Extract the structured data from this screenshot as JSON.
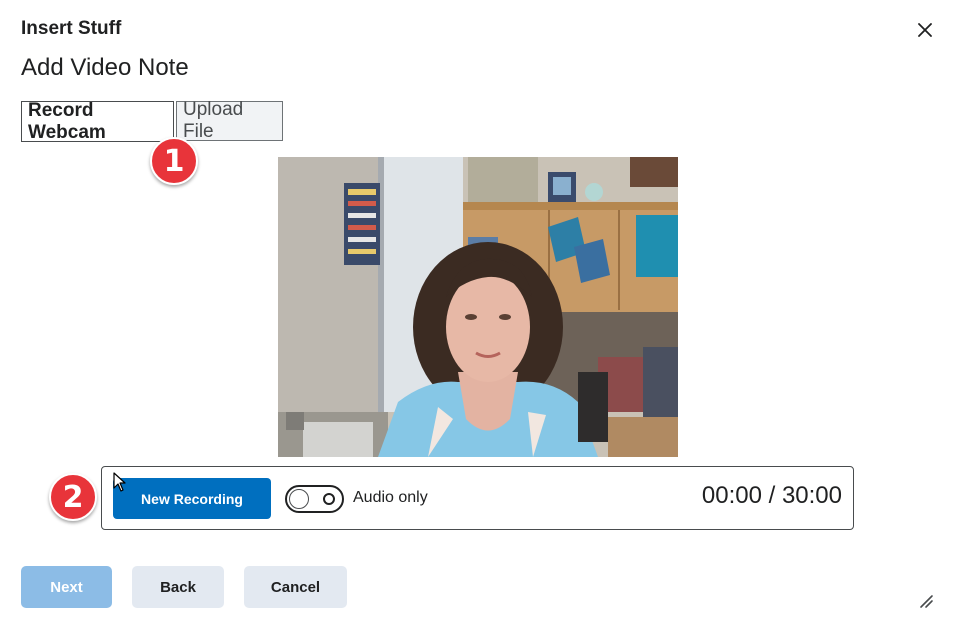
{
  "dialog": {
    "title": "Insert Stuff",
    "subtitle": "Add Video Note",
    "close_icon": "close-icon"
  },
  "tabs": [
    {
      "label": "Record Webcam",
      "active": true
    },
    {
      "label": "Upload File",
      "active": false
    }
  ],
  "annotations": {
    "badge_1": "1",
    "badge_2": "2",
    "color": "#e8343a"
  },
  "recorder": {
    "new_recording_label": "New Recording",
    "audio_only_label": "Audio only",
    "audio_only_enabled": false,
    "timer": "00:00 / 30:00"
  },
  "footer": {
    "next_label": "Next",
    "back_label": "Back",
    "cancel_label": "Cancel"
  },
  "colors": {
    "primary": "#006fbf",
    "primary_disabled": "#8cbce6",
    "secondary": "#e3e9f1",
    "text": "#202122"
  }
}
